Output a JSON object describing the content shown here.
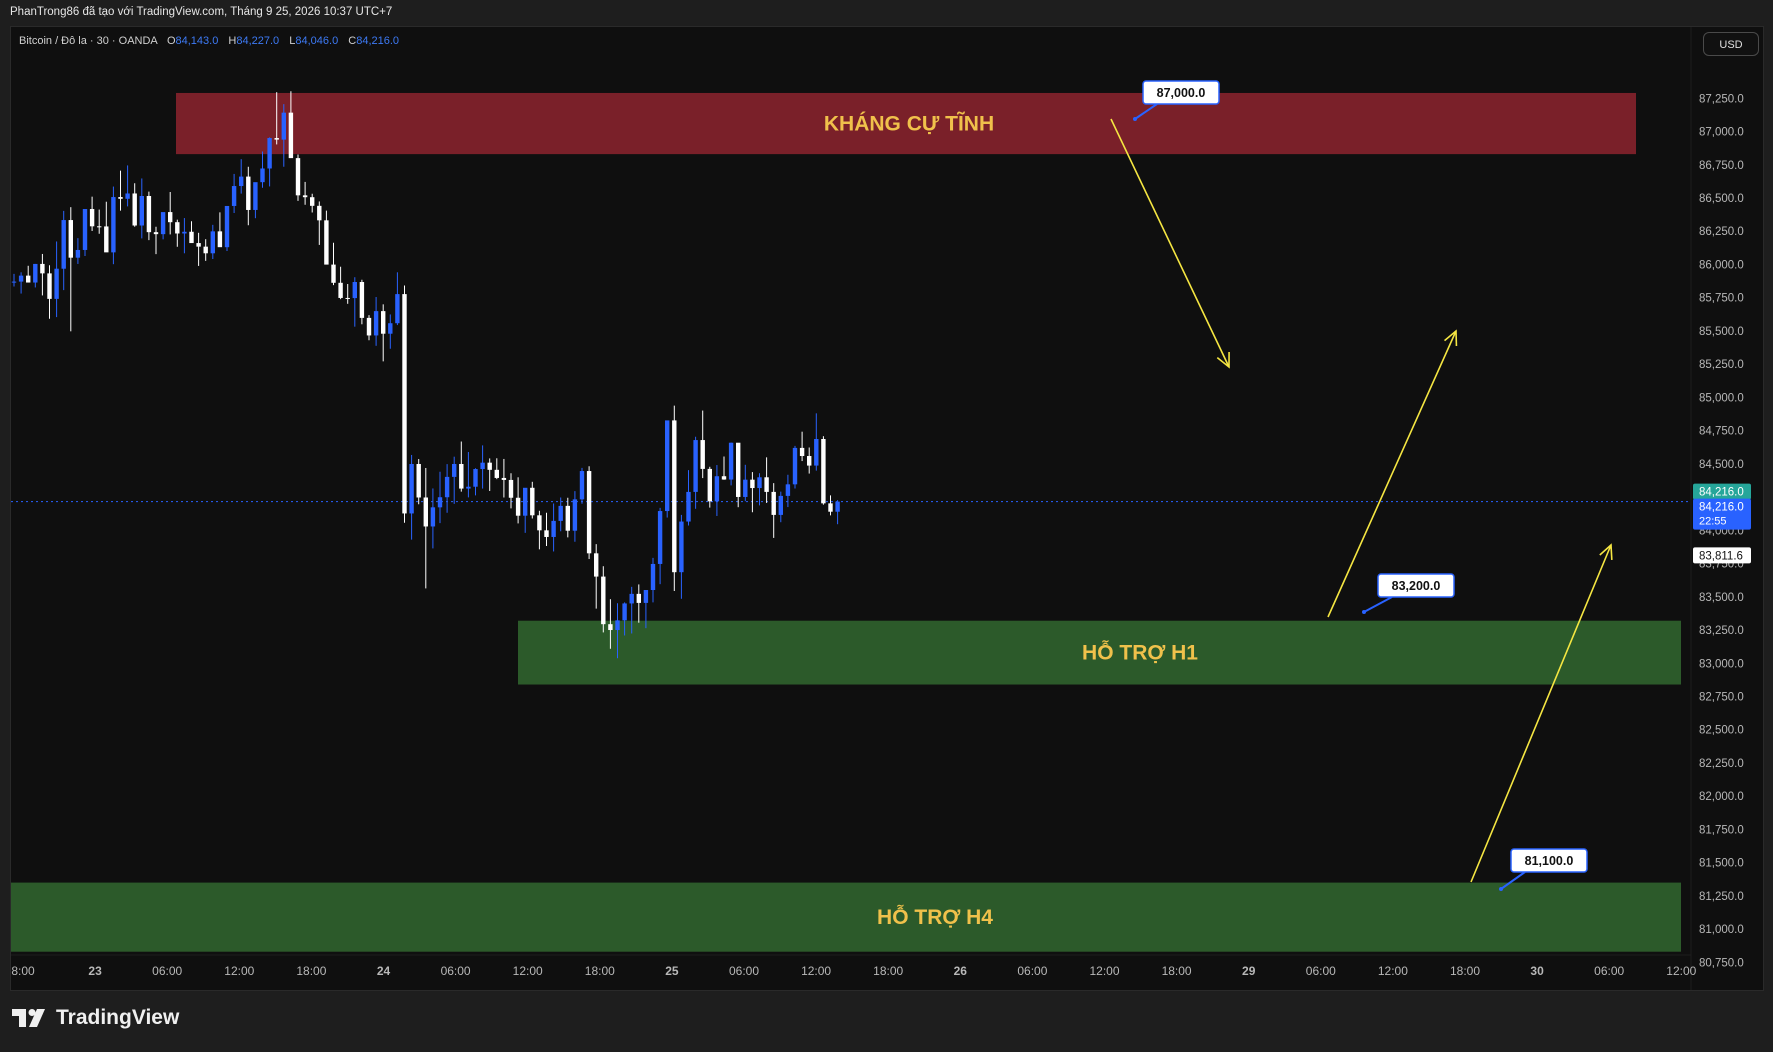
{
  "header": {
    "attribution": "PhanTrong86 đã tạo với TradingView.com, Tháng 9 25, 2026 10:37 UTC+7"
  },
  "legend": {
    "symbol": "Bitcoin / Đô la · 30 · OANDA",
    "o_label": "O",
    "o_value": "84,143.0",
    "h_label": "H",
    "h_value": "84,227.0",
    "l_label": "L",
    "l_value": "84,046.0",
    "c_label": "C",
    "c_value": "84,216.0"
  },
  "currency_button": "USD",
  "brand": {
    "name": "TradingView",
    "logo_icon": "tradingview-logo-icon"
  },
  "chart_data": {
    "type": "candlestick",
    "ylim": [
      80700,
      87350
    ],
    "y_ticks": [
      "87,250.0",
      "87,000.0",
      "86,750.0",
      "86,500.0",
      "86,250.0",
      "86,000.0",
      "85,750.0",
      "85,500.0",
      "85,250.0",
      "85,000.0",
      "84,750.0",
      "84,500.0",
      "84,250.0",
      "84,000.0",
      "83,750.0",
      "83,500.0",
      "83,250.0",
      "83,000.0",
      "82,750.0",
      "82,500.0",
      "82,250.0",
      "82,000.0",
      "81,750.0",
      "81,500.0",
      "81,250.0",
      "81,000.0",
      "80,750.0"
    ],
    "x_ticks": [
      "8:00",
      "23",
      "06:00",
      "12:00",
      "18:00",
      "24",
      "06:00",
      "12:00",
      "18:00",
      "25",
      "06:00",
      "12:00",
      "18:00",
      "26",
      "06:00",
      "12:00",
      "18:00",
      "29",
      "06:00",
      "12:00",
      "18:00",
      "30",
      "06:00",
      "12:00"
    ],
    "x_bold": [
      "23",
      "24",
      "25",
      "26",
      "29",
      "30"
    ],
    "candles_ohlc": [
      [
        85871,
        85929,
        85834,
        85871
      ],
      [
        85871,
        85941,
        85781,
        85916
      ],
      [
        85916,
        85990,
        85864,
        85864
      ],
      [
        85864,
        86004,
        85827,
        86004
      ],
      [
        86004,
        86079,
        85767,
        85933
      ],
      [
        85933,
        85994,
        85592,
        85741
      ],
      [
        85741,
        86173,
        85604,
        85968
      ],
      [
        85968,
        86403,
        85807,
        86334
      ],
      [
        86334,
        86431,
        85497,
        86051
      ],
      [
        86051,
        86198,
        86004,
        86109
      ],
      [
        86109,
        86417,
        86064,
        86417
      ],
      [
        86417,
        86510,
        86252,
        86287
      ],
      [
        86287,
        86413,
        86231,
        86286
      ],
      [
        86286,
        86472,
        86134,
        86091
      ],
      [
        86091,
        86586,
        86002,
        86507
      ],
      [
        86507,
        86706,
        86405,
        86494
      ],
      [
        86494,
        86745,
        86437,
        86534
      ],
      [
        86534,
        86611,
        86284,
        86293
      ],
      [
        86293,
        86647,
        86196,
        86515
      ],
      [
        86515,
        86548,
        86183,
        86243
      ],
      [
        86243,
        86284,
        86078,
        86228
      ],
      [
        86228,
        86381,
        86189,
        86394
      ],
      [
        86394,
        86545,
        86226,
        86318
      ],
      [
        86318,
        86337,
        86133,
        86233
      ],
      [
        86233,
        86349,
        86084,
        86246
      ],
      [
        86246,
        86325,
        86186,
        86161
      ],
      [
        86161,
        86238,
        85989,
        86134
      ],
      [
        86134,
        86190,
        86027,
        86084
      ],
      [
        86084,
        86298,
        86041,
        86249
      ],
      [
        86249,
        86392,
        86217,
        86130
      ],
      [
        86130,
        86427,
        86101,
        86440
      ],
      [
        86440,
        86681,
        86387,
        86590
      ],
      [
        86590,
        86792,
        86533,
        86661
      ],
      [
        86661,
        86735,
        86295,
        86410
      ],
      [
        86410,
        86582,
        86348,
        86619
      ],
      [
        86619,
        86850,
        86577,
        86722
      ],
      [
        86722,
        86956,
        86587,
        86951
      ],
      [
        86951,
        87296,
        86903,
        86939
      ],
      [
        86939,
        87206,
        86735,
        87142
      ],
      [
        87142,
        87303,
        86863,
        86800
      ],
      [
        86800,
        86827,
        86478,
        86520
      ],
      [
        86520,
        86621,
        86449,
        86506
      ],
      [
        86506,
        86532,
        86391,
        86441
      ],
      [
        86441,
        86474,
        86147,
        86332
      ],
      [
        86332,
        86405,
        86053,
        85999
      ],
      [
        85999,
        86163,
        85845,
        85862
      ],
      [
        85862,
        85983,
        85739,
        85748
      ],
      [
        85748,
        85853,
        85704,
        85747
      ],
      [
        85747,
        85904,
        85532,
        85868
      ],
      [
        85868,
        85885,
        85550,
        85598
      ],
      [
        85598,
        85619,
        85430,
        85466
      ],
      [
        85466,
        85755,
        85388,
        85649
      ],
      [
        85649,
        85700,
        85271,
        85479
      ],
      [
        85479,
        85624,
        85366,
        85558
      ],
      [
        85558,
        85941,
        85544,
        85777
      ],
      [
        85777,
        85842,
        84057,
        84127
      ],
      [
        84127,
        84567,
        83930,
        84499
      ],
      [
        84499,
        84536,
        84196,
        84247
      ],
      [
        84247,
        84469,
        83563,
        84029
      ],
      [
        84029,
        84315,
        83864,
        84173
      ],
      [
        84173,
        84441,
        84054,
        84249
      ],
      [
        84249,
        84498,
        84132,
        84402
      ],
      [
        84402,
        84554,
        84199,
        84499
      ],
      [
        84499,
        84668,
        84291,
        84314
      ],
      [
        84314,
        84589,
        84248,
        84328
      ],
      [
        84328,
        84467,
        84263,
        84461
      ],
      [
        84461,
        84639,
        84314,
        84509
      ],
      [
        84509,
        84541,
        84296,
        84455
      ],
      [
        84455,
        84542,
        84385,
        84394
      ],
      [
        84394,
        84537,
        84247,
        84379
      ],
      [
        84379,
        84429,
        84165,
        84245
      ],
      [
        84245,
        84399,
        84052,
        84110
      ],
      [
        84110,
        84310,
        83981,
        84320
      ],
      [
        84320,
        84365,
        84089,
        84113
      ],
      [
        84113,
        84147,
        83857,
        84000
      ],
      [
        84000,
        84132,
        83882,
        83950
      ],
      [
        83950,
        84202,
        83841,
        84071
      ],
      [
        84071,
        84247,
        83993,
        84184
      ],
      [
        84184,
        84245,
        83947,
        83997
      ],
      [
        83997,
        84295,
        83914,
        84233
      ],
      [
        84233,
        84470,
        84200,
        84446
      ],
      [
        84446,
        84482,
        83784,
        83827
      ],
      [
        83827,
        83896,
        83411,
        83652
      ],
      [
        83652,
        83730,
        83232,
        83294
      ],
      [
        83294,
        83482,
        83109,
        83250
      ],
      [
        83250,
        83451,
        83038,
        83323
      ],
      [
        83323,
        83458,
        83209,
        83450
      ],
      [
        83450,
        83575,
        83224,
        83522
      ],
      [
        83522,
        83593,
        83305,
        83454
      ],
      [
        83454,
        83546,
        83264,
        83551
      ],
      [
        83551,
        83793,
        83458,
        83747
      ],
      [
        83747,
        84169,
        83595,
        84145
      ],
      [
        84145,
        84824,
        84096,
        84827
      ],
      [
        84827,
        84938,
        83544,
        83685
      ],
      [
        83685,
        84116,
        83485,
        84066
      ],
      [
        84066,
        84453,
        84036,
        84289
      ],
      [
        84289,
        84704,
        84162,
        84679
      ],
      [
        84679,
        84901,
        84393,
        84462
      ],
      [
        84462,
        84478,
        84171,
        84218
      ],
      [
        84218,
        84491,
        84108,
        84407
      ],
      [
        84407,
        84555,
        84380,
        84382
      ],
      [
        84382,
        84660,
        84338,
        84659
      ],
      [
        84659,
        84646,
        84174,
        84251
      ],
      [
        84251,
        84493,
        84219,
        84381
      ],
      [
        84381,
        84438,
        84136,
        84318
      ],
      [
        84318,
        84429,
        84188,
        84399
      ],
      [
        84399,
        84549,
        84206,
        84289
      ],
      [
        84289,
        84355,
        83943,
        84116
      ],
      [
        84116,
        84291,
        84061,
        84259
      ],
      [
        84259,
        84418,
        84175,
        84346
      ],
      [
        84346,
        84635,
        84315,
        84620
      ],
      [
        84620,
        84742,
        84521,
        84559
      ],
      [
        84559,
        84623,
        84427,
        84487
      ],
      [
        84487,
        84880,
        84449,
        84687
      ],
      [
        84687,
        84708,
        84193,
        84203
      ],
      [
        84203,
        84263,
        84112,
        84140
      ],
      [
        84140,
        84227,
        84046,
        84216
      ]
    ],
    "zones": [
      {
        "label": "KHÁNG CỰ TĨNH",
        "y_from": 86830,
        "y_to": 87290,
        "color": "#7a2029",
        "text_color": "#f0c14b"
      },
      {
        "label": "HỖ TRỢ H1",
        "y_from": 82840,
        "y_to": 83320,
        "color": "#2c5a2a",
        "text_color": "#f0c14b"
      },
      {
        "label": "HỖ TRỢ H4",
        "y_from": 80830,
        "y_to": 81350,
        "color": "#2c5a2a",
        "text_color": "#f0c14b"
      }
    ],
    "price_callouts": [
      "87,000.0",
      "83,200.0",
      "81,100.0"
    ],
    "current_price": {
      "value": 84216,
      "label": "84,216.0",
      "countdown": "22:55",
      "color": "#2962ff"
    },
    "green_marker": {
      "label": "84,216.0",
      "color": "#26a69a"
    },
    "level_marker": {
      "label": "83,811.6"
    },
    "colors": {
      "up": "#2962ff",
      "down": "#ffffff",
      "arrow": "#f5e642",
      "axis_text": "#b8b8b8",
      "grid": "#0f0f0f"
    }
  }
}
